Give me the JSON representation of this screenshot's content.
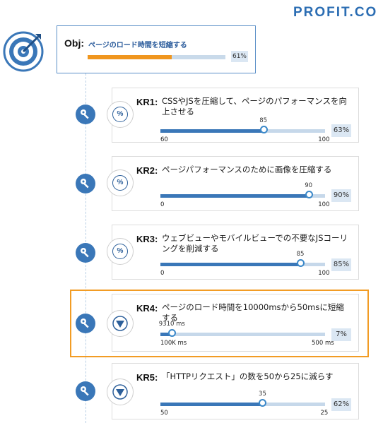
{
  "brand": {
    "logo_text": "PROFIT.CO"
  },
  "objective": {
    "label": "Obj:",
    "title": "ページのロード時間を短縮する",
    "progress_percent": 61,
    "progress_label": "61%",
    "bar_color": "#f0961e"
  },
  "key_results": [
    {
      "label": "KR1:",
      "title": "CSSやJSを圧縮して、ページのパフォーマンスを向上させる",
      "icon": "percent-icon",
      "start_label": "60",
      "target_label": "100",
      "current_label": "85",
      "progress_fraction": 0.625,
      "percent_label": "63%"
    },
    {
      "label": "KR2:",
      "title": "ページパフォーマンスのために画像を圧縮する",
      "icon": "percent-icon",
      "start_label": "0",
      "target_label": "100",
      "current_label": "90",
      "progress_fraction": 0.9,
      "percent_label": "90%"
    },
    {
      "label": "KR3:",
      "title": "ウェブビューやモバイルビューでの不要なJSコーリングを削減する",
      "icon": "percent-icon",
      "start_label": "0",
      "target_label": "100",
      "current_label": "85",
      "progress_fraction": 0.85,
      "percent_label": "85%"
    },
    {
      "label": "KR4:",
      "title": "ページのロード時間を10000msから50msに短縮する",
      "icon": "decrease-triangle-icon",
      "start_label": "100K ms",
      "target_label": "500 ms",
      "current_label": "9310 ms",
      "progress_fraction": 0.07,
      "percent_label": "7%"
    },
    {
      "label": "KR5:",
      "title": "「HTTPリクエスト」の数を50から25に減らす",
      "icon": "decrease-triangle-icon",
      "start_label": "50",
      "target_label": "25",
      "current_label": "35",
      "progress_fraction": 0.62,
      "percent_label": "62%"
    }
  ],
  "colors": {
    "brand_blue": "#2b6db3",
    "progress_blue": "#3a77b8",
    "highlight_orange": "#f29c24"
  }
}
